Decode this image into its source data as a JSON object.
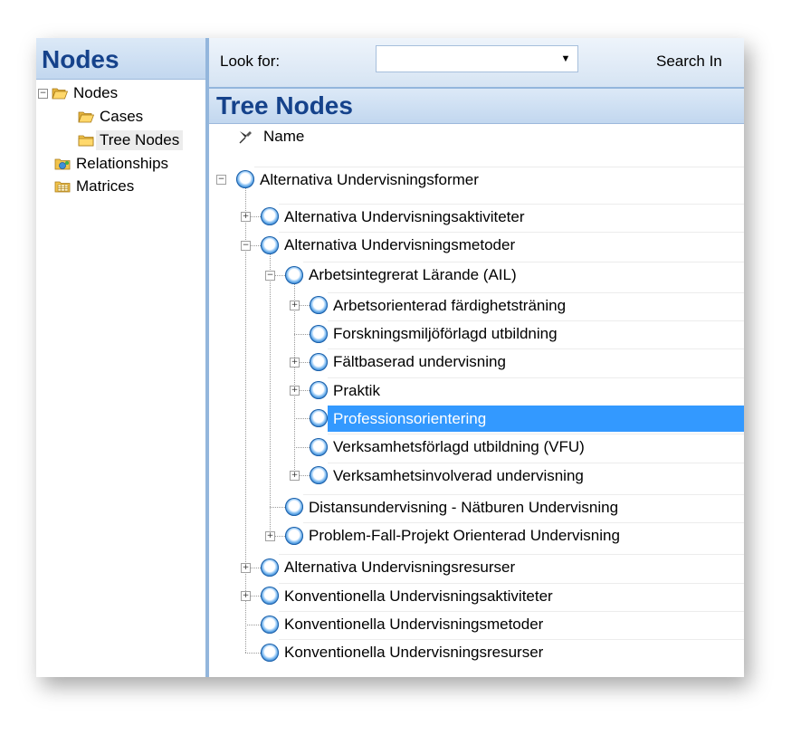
{
  "nav": {
    "title": "Nodes",
    "items": [
      {
        "label": "Nodes",
        "toggle": "−",
        "icon": "open-folder-icon"
      },
      {
        "label": "Cases",
        "icon": "open-folder-icon"
      },
      {
        "label": "Tree Nodes",
        "icon": "folder-icon",
        "selected": true
      },
      {
        "label": "Relationships",
        "icon": "relationships-icon"
      },
      {
        "label": "Matrices",
        "icon": "matrices-icon"
      }
    ]
  },
  "toolbar": {
    "look_for_label": "Look for:",
    "look_for_value": "",
    "dropdown_arrow": "▼",
    "search_in_label": "Search In"
  },
  "tree": {
    "title": "Tree Nodes",
    "column_name": "Name",
    "nodes": [
      {
        "label": "Alternativa Undervisningsformer",
        "depth": 0,
        "toggle": "−"
      },
      {
        "label": "Alternativa Undervisningsaktiviteter",
        "depth": 1,
        "toggle": "+"
      },
      {
        "label": "Alternativa Undervisningsmetoder",
        "depth": 1,
        "toggle": "−"
      },
      {
        "label": "Arbetsintegrerat Lärande (AIL)",
        "depth": 2,
        "toggle": "−"
      },
      {
        "label": "Arbetsorienterad färdighetsträning",
        "depth": 3,
        "toggle": "+"
      },
      {
        "label": "Forskningsmiljöförlagd utbildning",
        "depth": 3,
        "toggle": ""
      },
      {
        "label": "Fältbaserad undervisning",
        "depth": 3,
        "toggle": "+"
      },
      {
        "label": "Praktik",
        "depth": 3,
        "toggle": "+"
      },
      {
        "label": "Professionsorientering",
        "depth": 3,
        "toggle": "",
        "selected": true
      },
      {
        "label": "Verksamhetsförlagd utbildning (VFU)",
        "depth": 3,
        "toggle": ""
      },
      {
        "label": "Verksamhetsinvolverad undervisning",
        "depth": 3,
        "toggle": "+"
      },
      {
        "label": "Distansundervisning - Nätburen Undervisning",
        "depth": 2,
        "toggle": ""
      },
      {
        "label": "Problem-Fall-Projekt Orienterad Undervisning",
        "depth": 2,
        "toggle": "+"
      },
      {
        "label": "Alternativa Undervisningsresurser",
        "depth": 1,
        "toggle": "+"
      },
      {
        "label": "Konventionella Undervisningsaktiviteter",
        "depth": 1,
        "toggle": "+"
      },
      {
        "label": "Konventionella Undervisningsmetoder",
        "depth": 1,
        "toggle": ""
      },
      {
        "label": "Konventionella Undervisningsresurser",
        "depth": 1,
        "toggle": ""
      }
    ]
  },
  "colors": {
    "header_text": "#15428b",
    "selection": "#3399ff",
    "pane_border": "#93b6dc"
  }
}
